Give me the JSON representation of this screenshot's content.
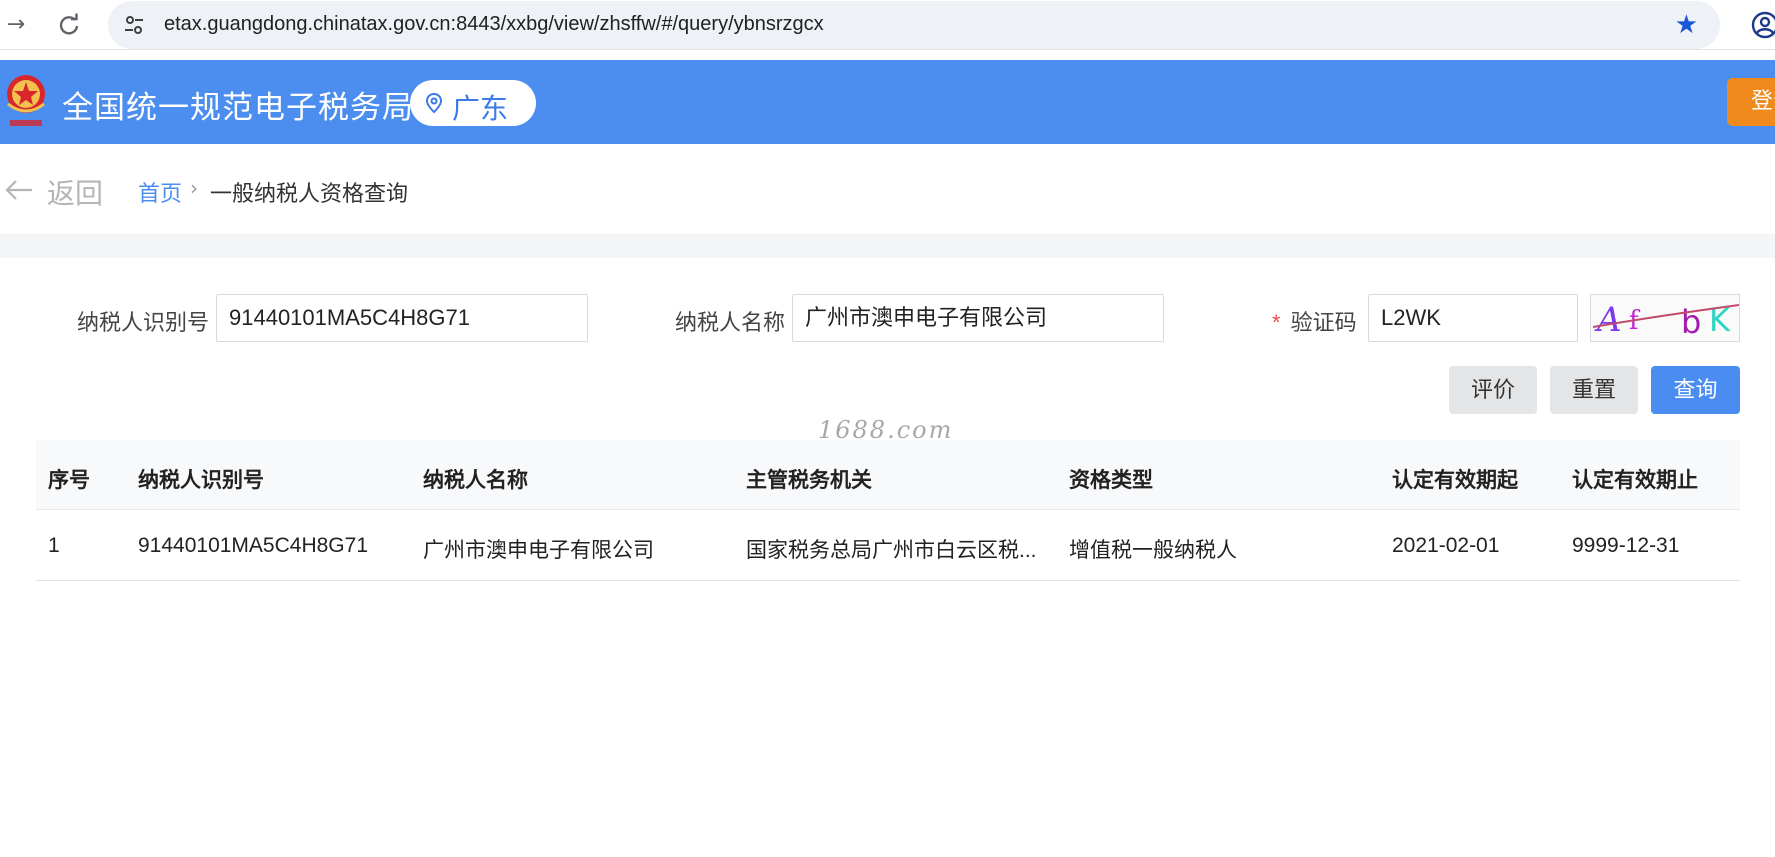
{
  "browser": {
    "url": "etax.guangdong.chinatax.gov.cn:8443/xxbg/view/zhsffw/#/query/ybnsrzgcx",
    "icons": {
      "forward": "forward-arrow-icon",
      "reload": "reload-icon",
      "site_info": "site-settings-icon",
      "bookmark": "star-icon",
      "profile": "profile-icon"
    }
  },
  "header": {
    "title": "全国统一规范电子税务局",
    "region": "广东",
    "login_label": "登录",
    "colors": {
      "bar": "#4b8ef0",
      "login": "#f08a1c"
    }
  },
  "breadcrumb": {
    "back_label": "返回",
    "home": "首页",
    "separator": "›",
    "current": "一般纳税人资格查询"
  },
  "form": {
    "taxpayer_id": {
      "label": "纳税人识别号",
      "value": "91440101MA5C4H8G71"
    },
    "taxpayer_name": {
      "label": "纳税人名称",
      "value": "广州市澳申电子有限公司"
    },
    "captcha": {
      "required_mark": "*",
      "label": "验证码",
      "value": "L2WK",
      "image_text": "AfbK"
    },
    "buttons": {
      "evaluate": "评价",
      "reset": "重置",
      "query": "查询"
    }
  },
  "watermark": "1688.com",
  "table": {
    "columns": [
      "序号",
      "纳税人识别号",
      "纳税人名称",
      "主管税务机关",
      "资格类型",
      "认定有效期起",
      "认定有效期止"
    ],
    "rows": [
      [
        "1",
        "91440101MA5C4H8G71",
        "广州市澳申电子有限公司",
        "国家税务总局广州市白云区税...",
        "增值税一般纳税人",
        "2021-02-01",
        "9999-12-31"
      ]
    ]
  }
}
